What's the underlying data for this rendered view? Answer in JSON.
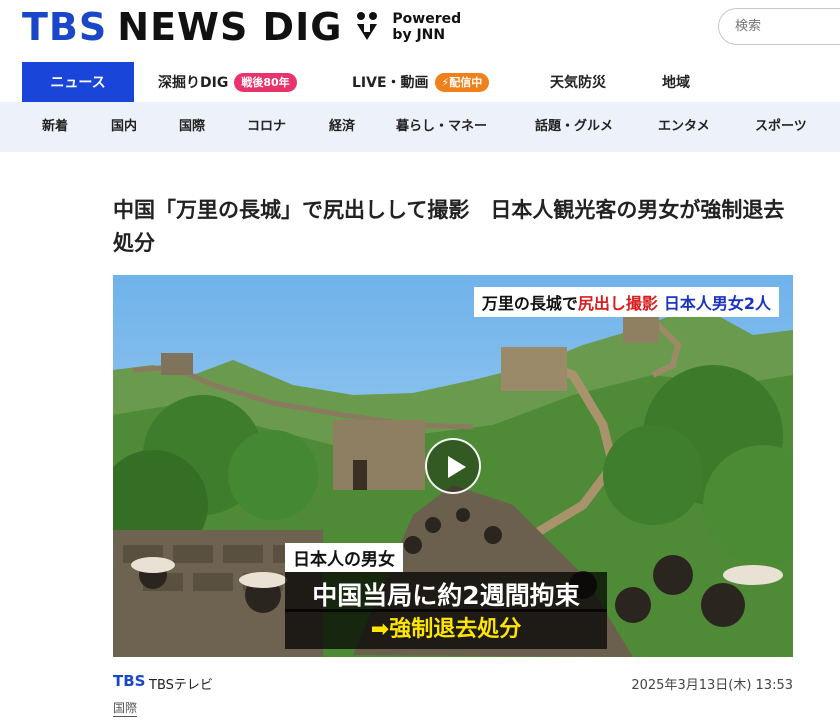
{
  "header": {
    "logo_primary": "TBS",
    "logo_secondary": "NEWS DIG",
    "powered_line1": "Powered",
    "powered_line2": "by JNN",
    "search_placeholder": "検索"
  },
  "main_nav": [
    {
      "label": "ニュース",
      "active": true
    },
    {
      "label": "深掘りDIG",
      "badge": "戦後80年",
      "badge_color": "#e8336b"
    },
    {
      "label": "LIVE・動画",
      "badge": "配信中",
      "badge_color": "#f08019"
    },
    {
      "label": "天気防災"
    },
    {
      "label": "地域"
    }
  ],
  "sub_nav": [
    "新着",
    "国内",
    "国際",
    "コロナ",
    "経済",
    "暮らし・マネー",
    "話題・グルメ",
    "エンタメ",
    "スポーツ"
  ],
  "article": {
    "title": "中国「万里の長城」で尻出しして撮影　日本人観光客の男女が強制退去処分",
    "video": {
      "top_caption_part1": "万里の長城で",
      "top_caption_part2": "尻出し撮影",
      "top_caption_part3": "日本人男女2人",
      "subtitle_label": "日本人の男女",
      "subtitle_main": "中国当局に約2週間拘束",
      "subtitle_arrow": "➡強制退去処分",
      "play_icon": "play-icon"
    },
    "source_logo": "TBS",
    "source_name": "TBSテレビ",
    "date": "2025年3月13日(木) 13:53",
    "category": "国際"
  },
  "colors": {
    "brand_blue": "#1946d8",
    "subnav_bg": "#edf1f9",
    "badge_pink": "#e8336b",
    "badge_orange": "#f08019"
  }
}
